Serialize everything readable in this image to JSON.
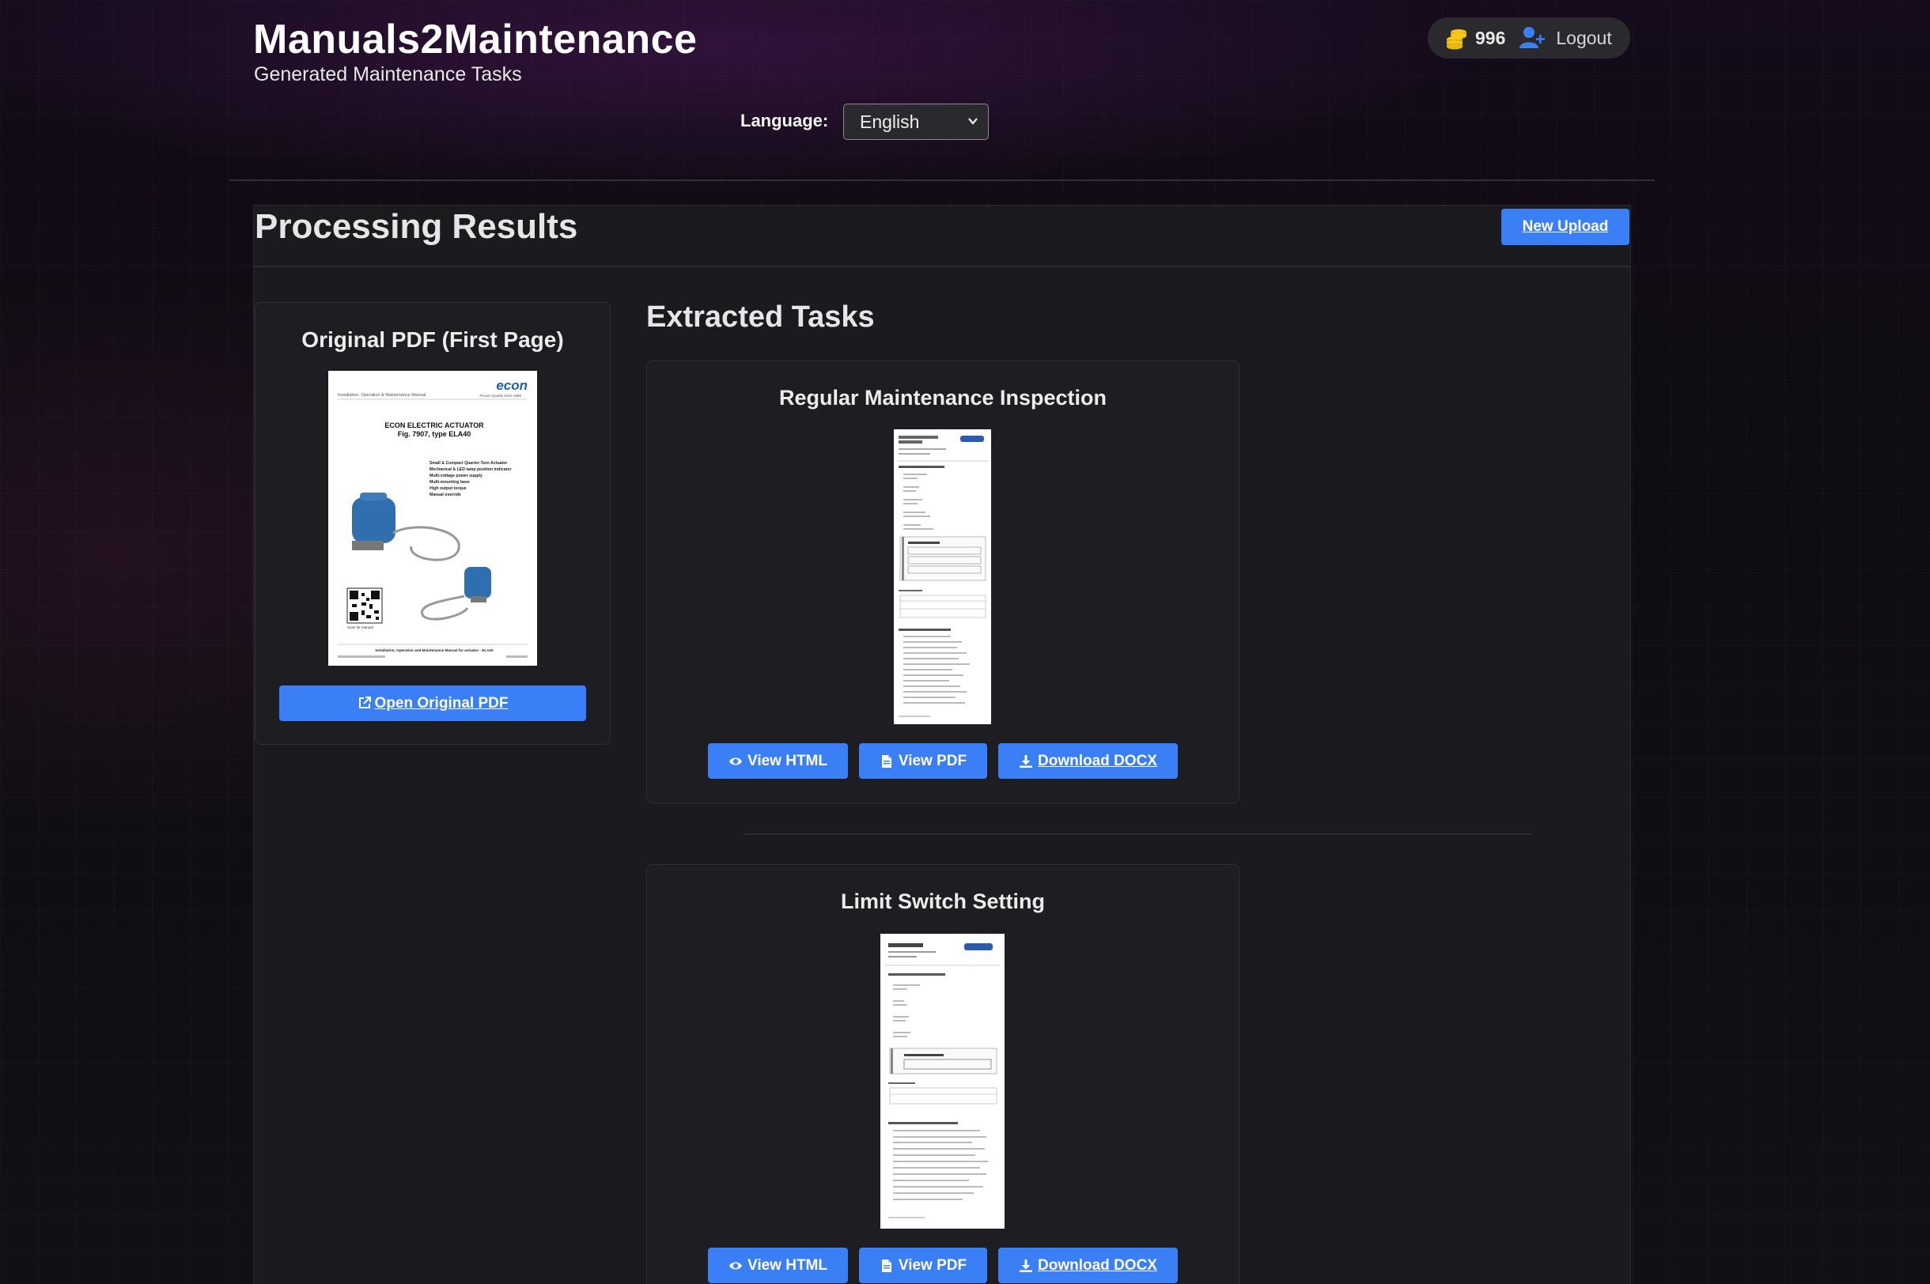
{
  "header": {
    "title": "Manuals2Maintenance",
    "subtitle": "Generated Maintenance Tasks",
    "coins": "996",
    "logout": "Logout",
    "language_label": "Language:",
    "language_value": "English"
  },
  "results": {
    "title": "Processing Results",
    "new_upload": "New Upload"
  },
  "original_pdf": {
    "title": "Original PDF (First Page)",
    "open_button": "Open Original PDF",
    "thumb": {
      "brand": "econ",
      "tagline": "Proven Quality since 1985",
      "doc_type": "Installation, Operation & Maintenance Manual",
      "heading1": "ECON ELECTRIC ACTUATOR",
      "heading2": "Fig. 7907,  type ELA40",
      "features": [
        "Small & Compact  Quarter-Turn Actuator",
        "Mechanical & LED lamp position indicator",
        "Multi-voltage power supply",
        "Multi-mounting base",
        "High output torque",
        "Manual override"
      ],
      "qr_caption": "Scan for manual",
      "footer": "Installation, Operation and Maintenance Manual for actuator - ELA40"
    }
  },
  "tasks": {
    "title": "Extracted Tasks",
    "items": [
      {
        "title": "Regular Maintenance Inspection",
        "view_html": "View HTML",
        "view_pdf": "View PDF",
        "download": "Download DOCX"
      },
      {
        "title": "Limit Switch Setting",
        "view_html": "View HTML",
        "view_pdf": "View PDF",
        "download": "Download DOCX"
      }
    ]
  },
  "colors": {
    "accent": "#3b7ff6",
    "panel": "#1b1b1f",
    "card": "#1e1e22",
    "coin": "#f5c518",
    "user_icon": "#3b7ff6"
  }
}
